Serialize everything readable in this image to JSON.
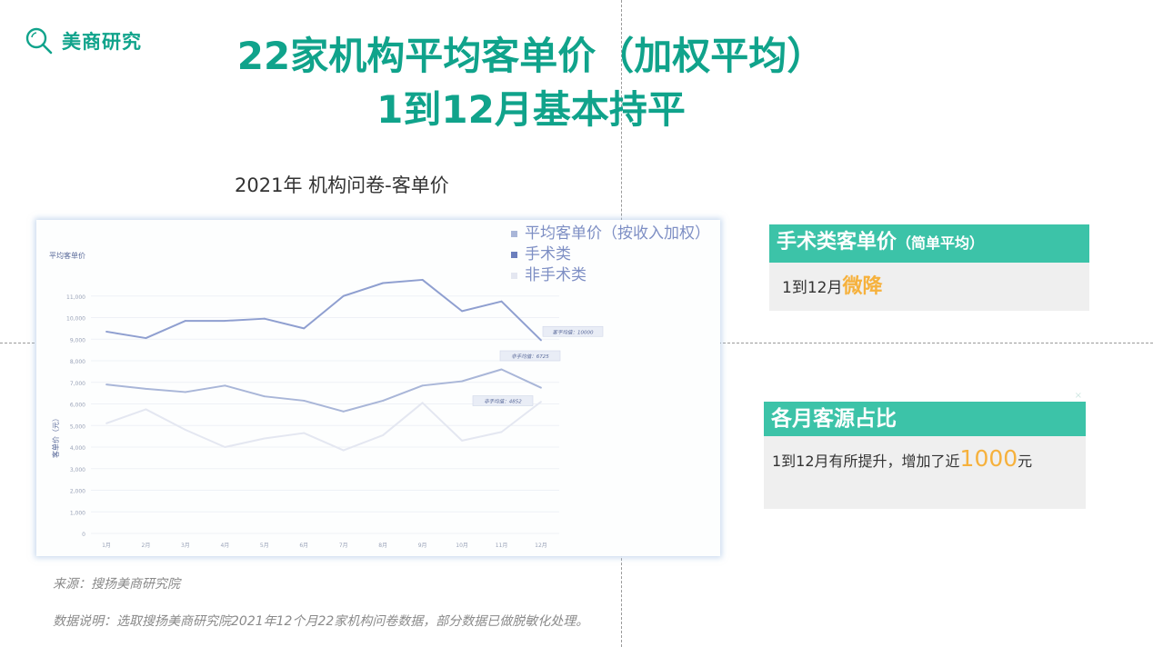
{
  "logo": {
    "text": "美商研究",
    "icon": "search-icon"
  },
  "title": {
    "line1": "22家机构平均客单价（加权平均）",
    "line2": "1到12月基本持平"
  },
  "chart_caption": "2021年 机构问卷-客单价",
  "chart_data": {
    "type": "line",
    "title": "平均客单价",
    "xlabel": "",
    "ylabel": "客单价（元）",
    "categories": [
      "1月",
      "2月",
      "3月",
      "4月",
      "5月",
      "6月",
      "7月",
      "8月",
      "9月",
      "10月",
      "11月",
      "12月"
    ],
    "y_ticks": [
      "0",
      "1,000",
      "2,000",
      "3,000",
      "4,000",
      "5,000",
      "6,000",
      "7,000",
      "8,000",
      "9,000",
      "10,000",
      "11,000"
    ],
    "ylim": [
      0,
      12000
    ],
    "grid": true,
    "legend_position": "top-right",
    "series": [
      {
        "name": "平均客单价（按收入加权）",
        "values": [
          6900,
          6700,
          6550,
          6850,
          6350,
          6150,
          5650,
          6150,
          6850,
          7050,
          7600,
          6750
        ],
        "color": "#a9b6d8"
      },
      {
        "name": "手术类",
        "values": [
          9350,
          9050,
          9850,
          9850,
          9950,
          9500,
          11000,
          11600,
          11750,
          10300,
          10750,
          8950
        ],
        "color": "#8f9fd0"
      },
      {
        "name": "非手术类",
        "values": [
          5100,
          5750,
          4800,
          4000,
          4400,
          4650,
          3850,
          4550,
          6050,
          4300,
          4700,
          6100
        ],
        "color": "#e4e7f1"
      }
    ],
    "annotations": [
      "客平均值：10000",
      "非手均值：6725",
      "非手均值：4852"
    ]
  },
  "card1": {
    "title": "手术类客单价",
    "title_small": "（简单平均）",
    "body_prefix": "1到12月",
    "body_highlight": "微降"
  },
  "card2": {
    "title": "各月客源占比",
    "body_prefix": "1到12月有所提升，增加了近",
    "body_highlight": "1000",
    "body_suffix": "元"
  },
  "source": "来源：搜扬美商研究院",
  "note": "数据说明：选取搜扬美商研究院2021年12个月22家机构问卷数据，部分数据已做脱敏化处理。"
}
